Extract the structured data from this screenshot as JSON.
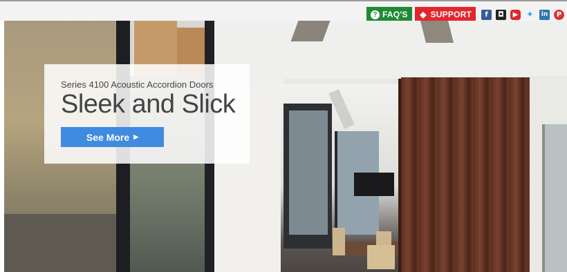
{
  "topbar": {
    "faq_label": "FAQ'S",
    "support_label": "SUPPORT",
    "social_icons": [
      "facebook-icon",
      "instagram-icon",
      "youtube-icon",
      "twitter-icon",
      "linkedin-icon",
      "pinterest-icon"
    ]
  },
  "hero": {
    "subtitle": "Series 4100 Acoustic Accordion Doors",
    "headline": "Sleek and Slick",
    "cta_label": "See More"
  },
  "colors": {
    "faq": "#1f8a36",
    "support": "#e3262e",
    "cta": "#3f8be0"
  }
}
